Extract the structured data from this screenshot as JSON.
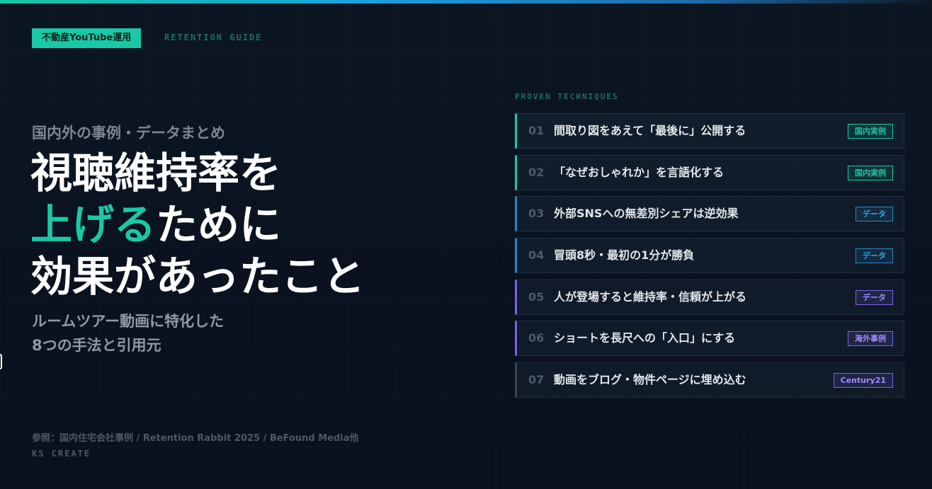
{
  "badge": "不動産YouTube運用",
  "eyebrow": "RETENTION GUIDE",
  "kicker": "国内外の事例・データまとめ",
  "headline": {
    "line1": "視聴維持率を",
    "line2_accent": "上げる",
    "line2_rest": "ために",
    "line3": "効果があったこと"
  },
  "subhead": {
    "line1": "ルームツアー動画に特化した",
    "line2": "8つの手法と引用元"
  },
  "source": "参照：国内住宅会社事例 / Retention Rabbit 2025 / BeFound Media他",
  "brand": "KS CREATE",
  "list_eyebrow": "PROVEN TECHNIQUES",
  "items": [
    {
      "num": "01",
      "label": "間取り図をあえて「最後に」公開する",
      "tag": "国内実例",
      "color": "green"
    },
    {
      "num": "02",
      "label": "「なぜおしゃれか」を言語化する",
      "tag": "国内実例",
      "color": "green"
    },
    {
      "num": "03",
      "label": "外部SNSへの無差別シェアは逆効果",
      "tag": "データ",
      "color": "blue"
    },
    {
      "num": "04",
      "label": "冒頭8秒・最初の1分が勝負",
      "tag": "データ",
      "color": "blue"
    },
    {
      "num": "05",
      "label": "人が登場すると維持率・信頼が上がる",
      "tag": "データ",
      "color": "purple"
    },
    {
      "num": "06",
      "label": "ショートを長尺への「入口」にする",
      "tag": "海外事例",
      "color": "purple"
    },
    {
      "num": "07",
      "label": "動画をブログ・物件ページに埋め込む",
      "tag": "Century21",
      "color": "gray"
    }
  ],
  "colors": {
    "accent_green": "#19c9a5",
    "accent_blue": "#2a86c2",
    "accent_purple": "#7c63e6",
    "background": "#0b1420"
  }
}
